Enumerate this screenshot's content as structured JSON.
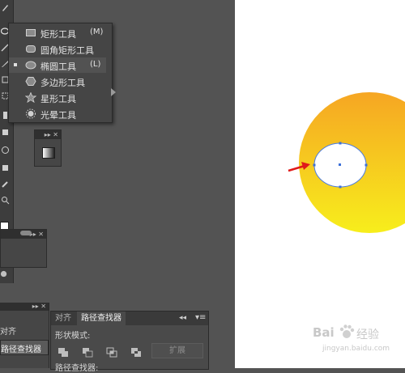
{
  "flyout": {
    "items": [
      {
        "label": "矩形工具",
        "key": "(M)",
        "icon": "rectangle-icon"
      },
      {
        "label": "圆角矩形工具",
        "key": "",
        "icon": "rounded-rectangle-icon"
      },
      {
        "label": "椭圆工具",
        "key": "(L)",
        "icon": "ellipse-icon",
        "selected": true
      },
      {
        "label": "多边形工具",
        "key": "",
        "icon": "polygon-icon"
      },
      {
        "label": "星形工具",
        "key": "",
        "icon": "star-icon"
      },
      {
        "label": "光晕工具",
        "key": "",
        "icon": "flare-icon"
      }
    ]
  },
  "left_panel": {
    "items": [
      "对齐",
      "路径查找器"
    ]
  },
  "pathfinder_panel": {
    "tabs": [
      "对齐",
      "路径查找器"
    ],
    "shape_modes_label": "形状模式:",
    "expand_label": "扩展",
    "pathfinders_label": "路径查找器:"
  },
  "watermark": {
    "brand": "Bai",
    "brand2": "经验",
    "url": "jingyan.baidu.com"
  },
  "colors": {
    "gradient_top": "#f6a623",
    "gradient_bottom": "#f7ee1c",
    "arrow": "#e01a1a",
    "anchor": "#3b6fd8"
  }
}
